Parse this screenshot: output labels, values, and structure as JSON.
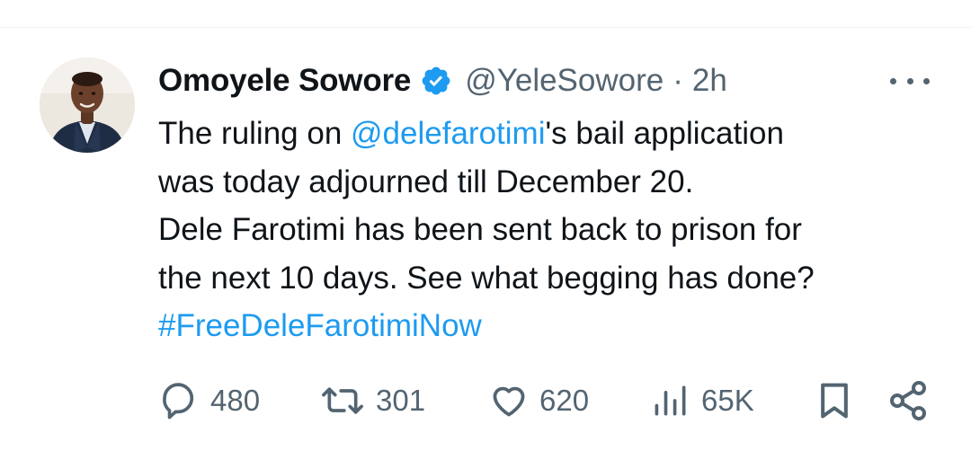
{
  "author": {
    "name": "Omoyele Sowore",
    "handle": "@YeleSowore",
    "separator": "·",
    "time": "2h",
    "verified": true
  },
  "tweet": {
    "line1_pre": "The ruling on ",
    "mention": "@delefarotimi",
    "line1_post": "'s bail application",
    "line2": "was today adjourned till December 20.",
    "line3": "Dele Farotimi has been sent back to prison for",
    "line4": "the next 10 days. See what begging has done?",
    "hashtag": "#FreeDeleFarotimiNow"
  },
  "actions": {
    "replies": "480",
    "reposts": "301",
    "likes": "620",
    "views": "65K"
  },
  "icons": {
    "more": "more-horizontal-icon",
    "reply": "reply-bubble-icon",
    "repost": "repost-icon",
    "like": "heart-icon",
    "views": "views-bar-chart-icon",
    "bookmark": "bookmark-icon",
    "share": "share-icon",
    "verified": "verified-badge-icon"
  },
  "colors": {
    "link": "#1d9bf0",
    "text": "#0f1419",
    "muted": "#536471",
    "verified": "#1d9bf0"
  }
}
